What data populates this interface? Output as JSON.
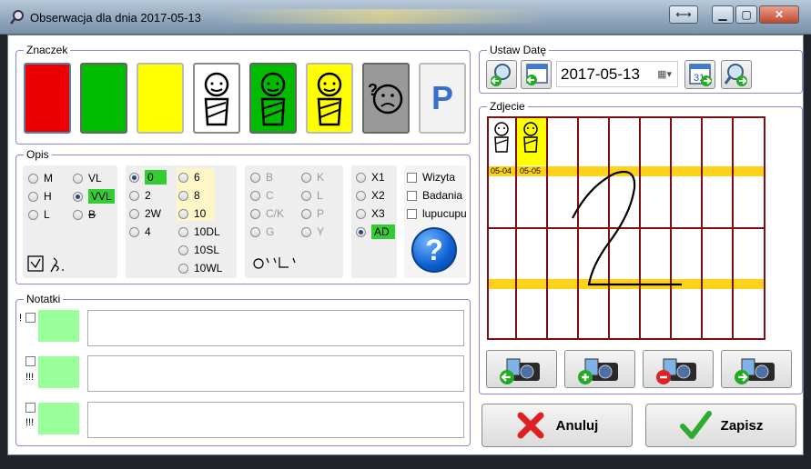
{
  "window": {
    "title": "Obserwacja dla dnia 2017-05-13"
  },
  "znaczek": {
    "legend": "Znaczek",
    "tiles": [
      "red",
      "green",
      "yellow",
      "baby-white",
      "baby-green",
      "baby-yellow",
      "sad-face",
      "P"
    ],
    "p_label": "P"
  },
  "opis": {
    "legend": "Opis",
    "col1": [
      "M",
      "H",
      "L"
    ],
    "col2": [
      "VL",
      "VVL",
      "B"
    ],
    "col2_selected": "VVL",
    "col3": [
      "0",
      "2",
      "2W",
      "4"
    ],
    "col3_selected": "0",
    "col4": [
      "6",
      "8",
      "10",
      "10DL",
      "10SL",
      "10WL"
    ],
    "col5": [
      "B",
      "C",
      "C/K",
      "G"
    ],
    "col6": [
      "K",
      "L",
      "P",
      "Y"
    ],
    "col7": [
      "X1",
      "X2",
      "X3",
      "AD"
    ],
    "col7_selected": "AD",
    "checks": [
      "Wizyta",
      "Badania",
      "lupucupu"
    ],
    "help": "?"
  },
  "notatki": {
    "legend": "Notatki",
    "rows": [
      {
        "mark": "!"
      },
      {
        "mark": "!!!"
      },
      {
        "mark": "!!!"
      }
    ]
  },
  "ustaw_date": {
    "legend": "Ustaw Datę",
    "date": "2017-05-13",
    "calendar_day": "31"
  },
  "zdjecie": {
    "legend": "Zdjecie",
    "days": [
      "05-04",
      "05-05"
    ],
    "overlay_number": "2"
  },
  "buttons": {
    "cancel": "Anuluj",
    "save": "Zapisz"
  },
  "colors": {
    "red": "#ee0000",
    "green": "#00bb00",
    "yellow": "#ffff00",
    "grey": "#999999",
    "grid": "#7a1010",
    "band": "#ffd21a",
    "note": "#99ff99",
    "selected": "#33cc33"
  }
}
